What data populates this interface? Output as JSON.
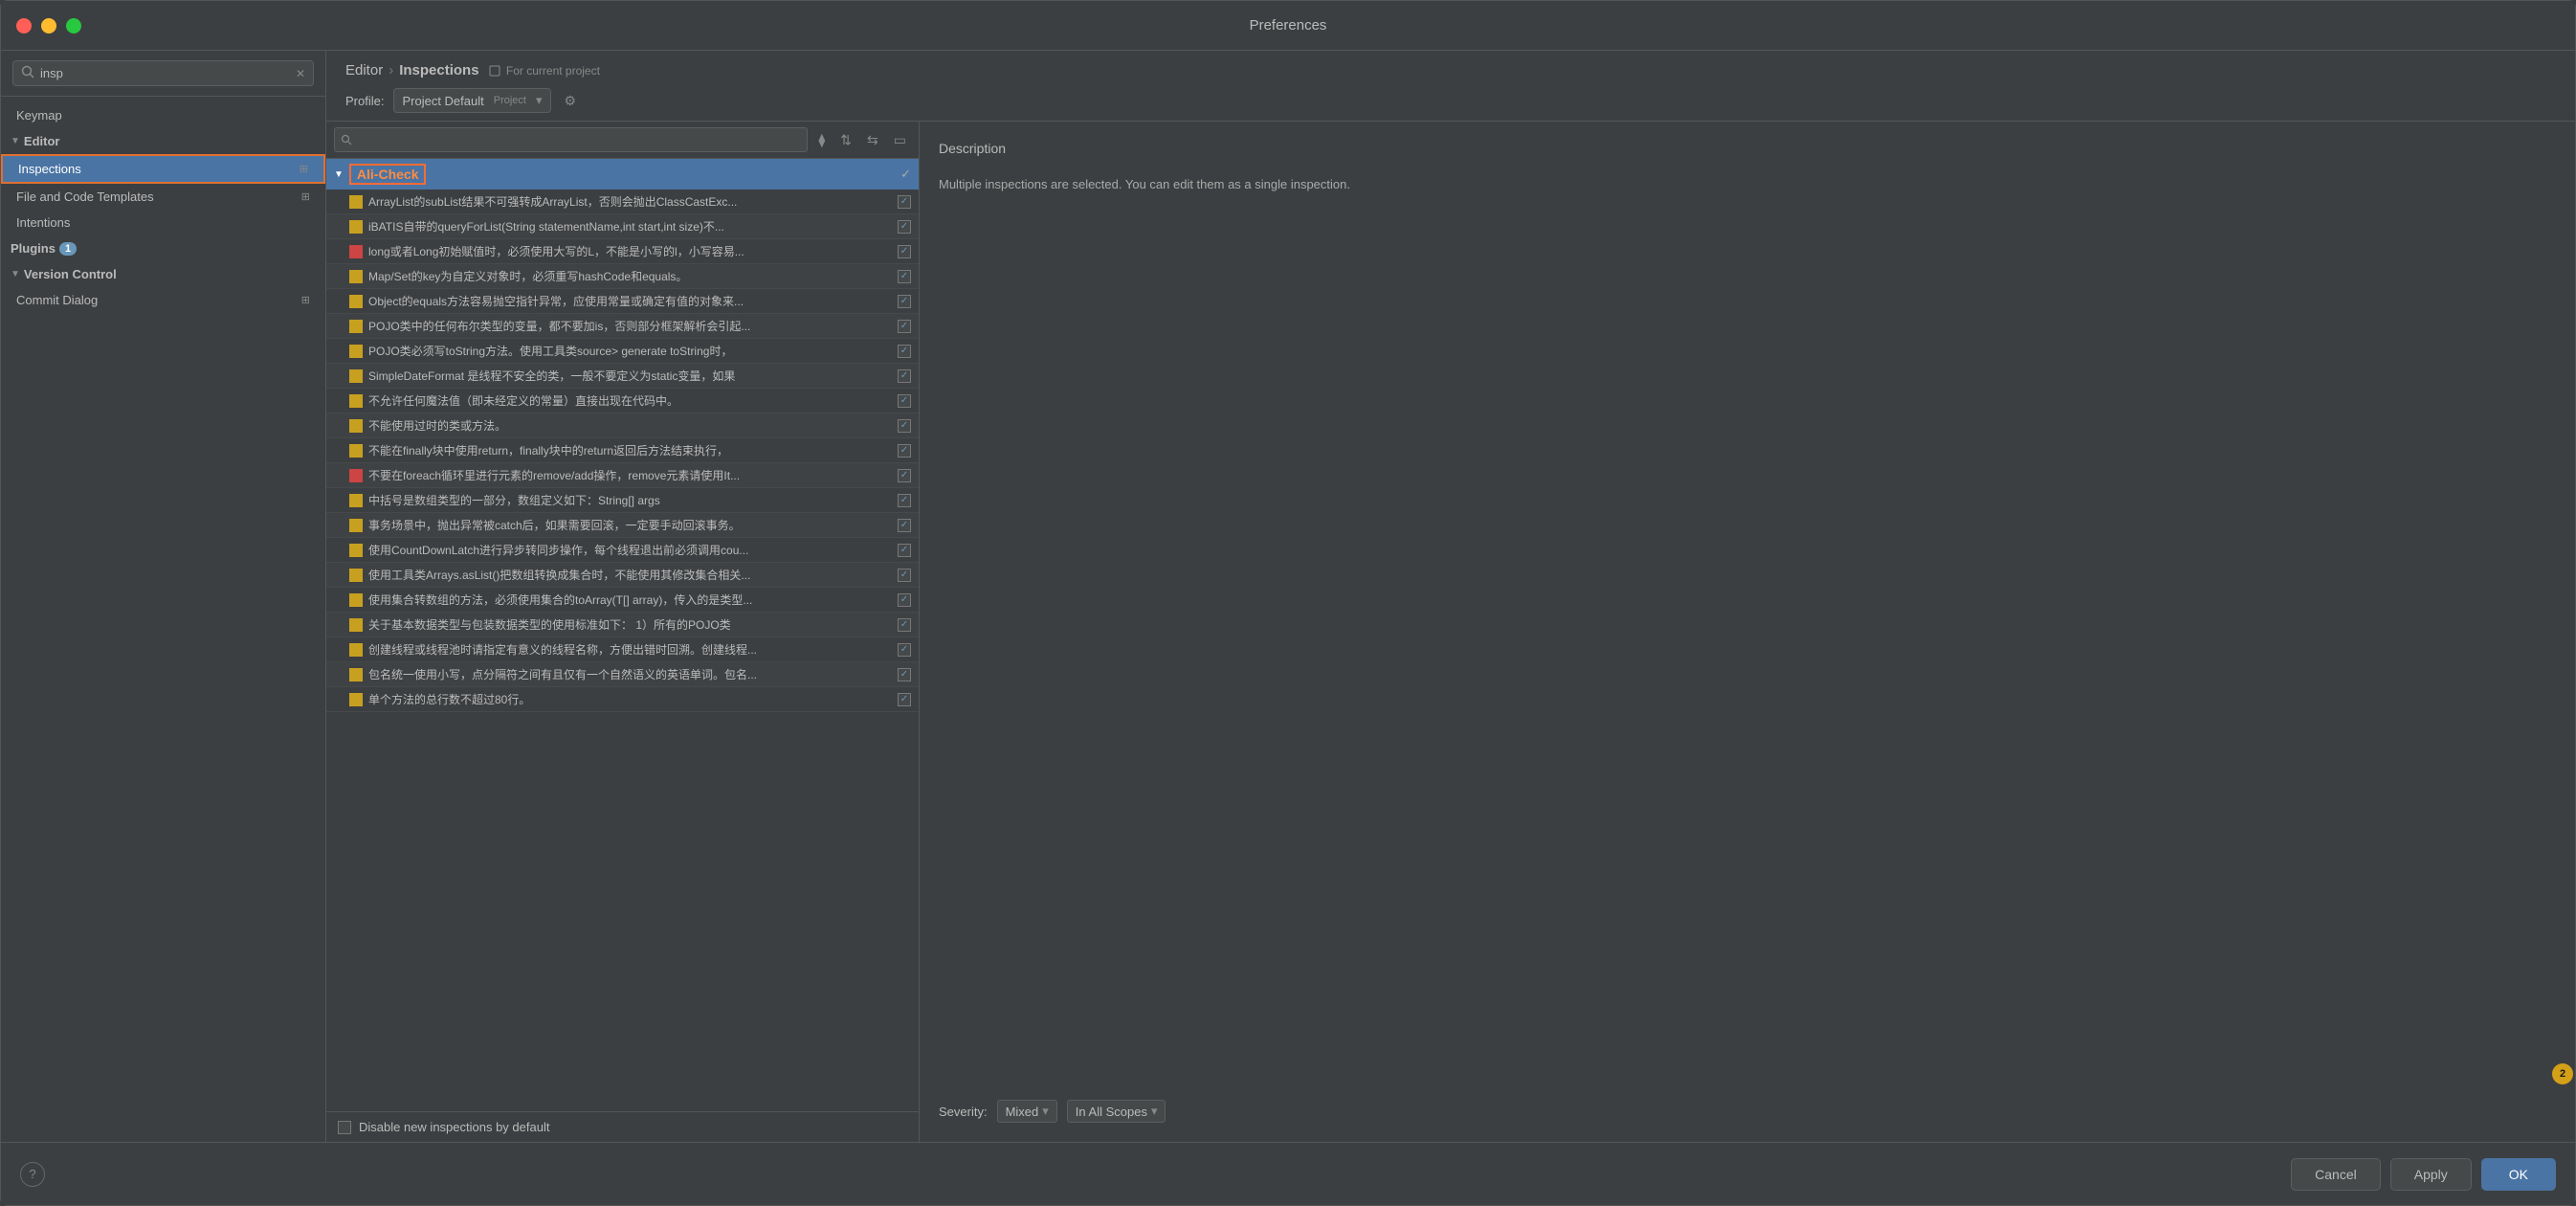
{
  "window": {
    "title": "Preferences"
  },
  "sidebar": {
    "search_placeholder": "insp",
    "items": [
      {
        "id": "keymap",
        "label": "Keymap",
        "indent": 0,
        "type": "leaf"
      },
      {
        "id": "editor",
        "label": "Editor",
        "indent": 0,
        "type": "section",
        "expanded": true
      },
      {
        "id": "inspections",
        "label": "Inspections",
        "indent": 1,
        "type": "leaf",
        "selected": true
      },
      {
        "id": "file-code-templates",
        "label": "File and Code Templates",
        "indent": 1,
        "type": "leaf"
      },
      {
        "id": "intentions",
        "label": "Intentions",
        "indent": 1,
        "type": "leaf"
      },
      {
        "id": "plugins",
        "label": "Plugins",
        "indent": 0,
        "type": "section",
        "badge": "1"
      },
      {
        "id": "version-control",
        "label": "Version Control",
        "indent": 0,
        "type": "section",
        "expanded": true
      },
      {
        "id": "commit-dialog",
        "label": "Commit Dialog",
        "indent": 1,
        "type": "leaf"
      }
    ]
  },
  "header": {
    "breadcrumb_parent": "Editor",
    "breadcrumb_child": "Inspections",
    "for_current_project": "For current project",
    "profile_label": "Profile:",
    "profile_value": "Project Default",
    "profile_tag": "Project"
  },
  "inspections_group": {
    "name": "Ali-Check",
    "checkmark": true
  },
  "inspection_items": [
    {
      "text": "ArrayList的subList结果不可强转成ArrayList，否则会抛出ClassCastExc...",
      "color": "#c8a020",
      "checked": true
    },
    {
      "text": "iBATIS自带的queryForList(String statementName,int start,int size)不...",
      "color": "#c8a020",
      "checked": true
    },
    {
      "text": "long或者Long初始赋值时，必须使用大写的L，不能是小写的l，小写容易...",
      "color": "#cc4444",
      "checked": true
    },
    {
      "text": "Map/Set的key为自定义对象时，必须重写hashCode和equals。",
      "color": "#c8a020",
      "checked": true
    },
    {
      "text": "Object的equals方法容易抛空指针异常，应使用常量或确定有值的对象来...",
      "color": "#c8a020",
      "checked": true
    },
    {
      "text": "POJO类中的任何布尔类型的变量，都不要加is，否则部分框架解析会引起...",
      "color": "#c8a020",
      "checked": true
    },
    {
      "text": "POJO类必须写toString方法。使用工具类source> generate toString时，",
      "color": "#c8a020",
      "checked": true
    },
    {
      "text": "SimpleDateFormat 是线程不安全的类，一般不要定义为static变量，如果",
      "color": "#c8a020",
      "checked": true
    },
    {
      "text": "不允许任何魔法值（即未经定义的常量）直接出现在代码中。",
      "color": "#c8a020",
      "checked": true
    },
    {
      "text": "不能使用过时的类或方法。",
      "color": "#c8a020",
      "checked": true
    },
    {
      "text": "不能在finally块中使用return，finally块中的return返回后方法结束执行，",
      "color": "#c8a020",
      "checked": true
    },
    {
      "text": "不要在foreach循环里进行元素的remove/add操作，remove元素请使用It...",
      "color": "#cc4444",
      "checked": true
    },
    {
      "text": "中括号是数组类型的一部分，数组定义如下：String[] args",
      "color": "#c8a020",
      "checked": true
    },
    {
      "text": "事务场景中，抛出异常被catch后，如果需要回滚，一定要手动回滚事务。",
      "color": "#c8a020",
      "checked": true
    },
    {
      "text": "使用CountDownLatch进行异步转同步操作，每个线程退出前必须调用cou...",
      "color": "#c8a020",
      "checked": true
    },
    {
      "text": "使用工具类Arrays.asList()把数组转换成集合时，不能使用其修改集合相关...",
      "color": "#c8a020",
      "checked": true
    },
    {
      "text": "使用集合转数组的方法，必须使用集合的toArray(T[] array)，传入的是类型...",
      "color": "#c8a020",
      "checked": true
    },
    {
      "text": "关于基本数据类型与包装数据类型的使用标准如下：    1）所有的POJO类",
      "color": "#c8a020",
      "checked": true
    },
    {
      "text": "创建线程或线程池时请指定有意义的线程名称，方便出错时回溯。创建线程...",
      "color": "#c8a020",
      "checked": true
    },
    {
      "text": "包名统一使用小写，点分隔符之间有且仅有一个自然语义的英语单词。包名...",
      "color": "#c8a020",
      "checked": true
    },
    {
      "text": "单个方法的总行数不超过80行。",
      "color": "#c8a020",
      "checked": true
    }
  ],
  "disable_row": {
    "label": "Disable new inspections by default",
    "checked": false
  },
  "description": {
    "title": "Description",
    "text": "Multiple inspections are selected. You can edit them as a single inspection."
  },
  "severity": {
    "label": "Severity:",
    "value": "Mixed",
    "scope_value": "In All Scopes"
  },
  "footer": {
    "cancel_label": "Cancel",
    "apply_label": "Apply",
    "ok_label": "OK"
  }
}
